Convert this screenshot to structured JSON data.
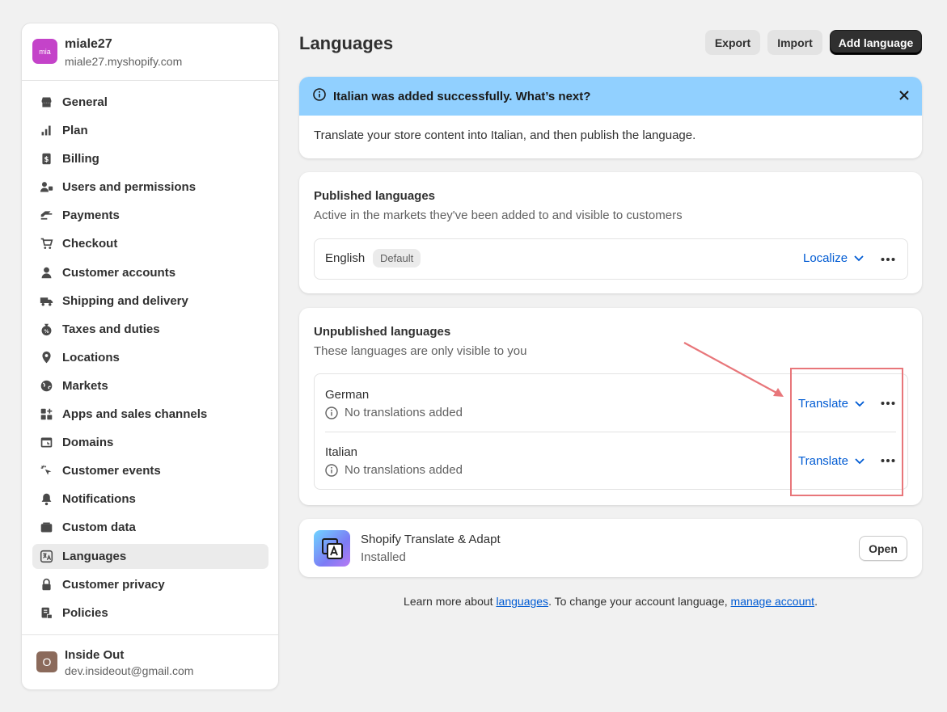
{
  "store": {
    "avatar_text": "mia",
    "name": "miale27",
    "domain": "miale27.myshopify.com"
  },
  "sidebar": {
    "items": [
      {
        "label": "General",
        "icon": "store-icon"
      },
      {
        "label": "Plan",
        "icon": "plan-icon"
      },
      {
        "label": "Billing",
        "icon": "billing-icon"
      },
      {
        "label": "Users and permissions",
        "icon": "users-icon"
      },
      {
        "label": "Payments",
        "icon": "payments-icon"
      },
      {
        "label": "Checkout",
        "icon": "cart-icon"
      },
      {
        "label": "Customer accounts",
        "icon": "person-icon"
      },
      {
        "label": "Shipping and delivery",
        "icon": "truck-icon"
      },
      {
        "label": "Taxes and duties",
        "icon": "tax-icon"
      },
      {
        "label": "Locations",
        "icon": "location-icon"
      },
      {
        "label": "Markets",
        "icon": "globe-icon"
      },
      {
        "label": "Apps and sales channels",
        "icon": "apps-icon"
      },
      {
        "label": "Domains",
        "icon": "domain-icon"
      },
      {
        "label": "Customer events",
        "icon": "cursor-icon"
      },
      {
        "label": "Notifications",
        "icon": "bell-icon"
      },
      {
        "label": "Custom data",
        "icon": "data-icon"
      },
      {
        "label": "Languages",
        "icon": "language-icon",
        "active": true
      },
      {
        "label": "Customer privacy",
        "icon": "lock-icon"
      },
      {
        "label": "Policies",
        "icon": "policy-icon"
      }
    ]
  },
  "user": {
    "avatar_text": "O",
    "name": "Inside Out",
    "email": "dev.insideout@gmail.com"
  },
  "header": {
    "title": "Languages",
    "export_label": "Export",
    "import_label": "Import",
    "add_label": "Add language"
  },
  "banner": {
    "title": "Italian was added successfully. What’s next?",
    "body": "Translate your store content into Italian, and then publish the language."
  },
  "published": {
    "title": "Published languages",
    "subtitle": "Active in the markets they've been added to and visible to customers",
    "languages": [
      {
        "name": "English",
        "badge": "Default",
        "action": "Localize"
      }
    ]
  },
  "unpublished": {
    "title": "Unpublished languages",
    "subtitle": "These languages are only visible to you",
    "languages": [
      {
        "name": "German",
        "status": "No translations added",
        "action": "Translate"
      },
      {
        "name": "Italian",
        "status": "No translations added",
        "action": "Translate"
      }
    ]
  },
  "app": {
    "name": "Shopify Translate & Adapt",
    "status": "Installed",
    "open_label": "Open"
  },
  "footer": {
    "prefix": "Learn more about ",
    "link1": "languages",
    "middle": ". To change your account language, ",
    "link2": "manage account",
    "suffix": "."
  },
  "colors": {
    "accent_link": "#005bd3",
    "banner_bg": "#91d0ff",
    "annotation": "#e8767a",
    "store_avatar": "#c443c9"
  }
}
